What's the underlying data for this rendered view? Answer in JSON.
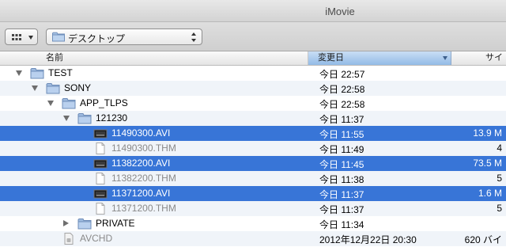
{
  "window": {
    "title": "iMovie"
  },
  "toolbar": {
    "location": "デスクトップ"
  },
  "columns": {
    "name": "名前",
    "date": "変更日",
    "size": "サイ"
  },
  "rows": [
    {
      "name": "TEST",
      "date": "今日 22:57",
      "size": "",
      "kind": "folder",
      "level": 0,
      "disclosure": "open",
      "selected": false
    },
    {
      "name": "SONY",
      "date": "今日 22:58",
      "size": "",
      "kind": "folder",
      "level": 1,
      "disclosure": "open",
      "selected": false
    },
    {
      "name": "APP_TLPS",
      "date": "今日 22:58",
      "size": "",
      "kind": "folder",
      "level": 2,
      "disclosure": "open",
      "selected": false
    },
    {
      "name": "121230",
      "date": "今日 11:37",
      "size": "",
      "kind": "folder",
      "level": 3,
      "disclosure": "open",
      "selected": false
    },
    {
      "name": "11490300.AVI",
      "date": "今日 11:55",
      "size": "13.9 M",
      "kind": "video",
      "level": 4,
      "disclosure": "none",
      "selected": true
    },
    {
      "name": "11490300.THM",
      "date": "今日 11:49",
      "size": "4",
      "kind": "doc",
      "level": 4,
      "disclosure": "none",
      "selected": false
    },
    {
      "name": "11382200.AVI",
      "date": "今日 11:45",
      "size": "73.5 M",
      "kind": "video",
      "level": 4,
      "disclosure": "none",
      "selected": true
    },
    {
      "name": "11382200.THM",
      "date": "今日 11:38",
      "size": "5",
      "kind": "doc",
      "level": 4,
      "disclosure": "none",
      "selected": false
    },
    {
      "name": "11371200.AVI",
      "date": "今日 11:37",
      "size": "1.6 M",
      "kind": "video",
      "level": 4,
      "disclosure": "none",
      "selected": true
    },
    {
      "name": "11371200.THM",
      "date": "今日 11:37",
      "size": "5",
      "kind": "doc",
      "level": 4,
      "disclosure": "none",
      "selected": false
    },
    {
      "name": "PRIVATE",
      "date": "今日 11:34",
      "size": "",
      "kind": "folder",
      "level": 3,
      "disclosure": "closed",
      "selected": false
    },
    {
      "name": "AVCHD",
      "date": "2012年12月22日 20:30",
      "size": "620 バイ",
      "kind": "package",
      "level": 2,
      "disclosure": "none",
      "selected": false
    }
  ]
}
